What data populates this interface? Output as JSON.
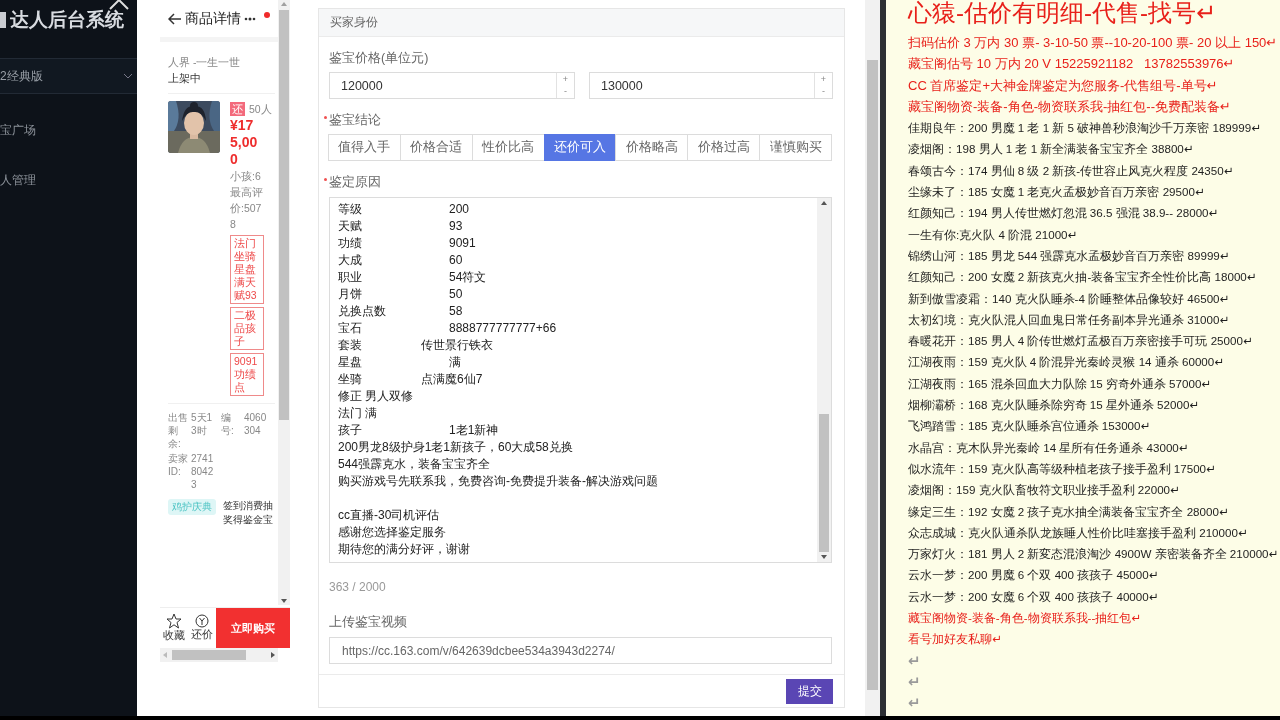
{
  "sidebar": {
    "title": "达人后台系统",
    "version_select": "2经典版",
    "items": [
      {
        "label": "宝广场",
        "selected": false
      },
      {
        "label": "人管理",
        "selected": false
      }
    ]
  },
  "preview": {
    "title": "商品详情",
    "server": "人界 -一生一世",
    "status": "上架中",
    "badge": "还",
    "watchers": "50人",
    "price": "¥175,000",
    "kids": "小孩:6",
    "rating": "最高评价:5078",
    "tags": [
      "法门坐骑星盘满天赋93",
      "二极品孩子",
      "9091功绩点"
    ],
    "info": [
      {
        "label": "出售剩余:",
        "value": "5天13时"
      },
      {
        "label": "编号:",
        "value": "4060304"
      },
      {
        "label": "卖家ID:",
        "value": "274180423"
      }
    ],
    "promo_tag": "鸡护庆典",
    "promo_text": "签到消费抽奖得鉴金宝",
    "favorite": "收藏",
    "bargain": "还价",
    "buy": "立即购买"
  },
  "form": {
    "header": "买家身份",
    "price_label": "鉴宝价格(单位元)",
    "prices": [
      {
        "value": "120000",
        "up": "+",
        "down": "-"
      },
      {
        "value": "130000",
        "up": "+",
        "down": "-"
      }
    ],
    "verdict_label": "鉴宝结论",
    "verdict_required": true,
    "verdicts": [
      {
        "label": "值得入手",
        "selected": false
      },
      {
        "label": "价格合适",
        "selected": false
      },
      {
        "label": "性价比高",
        "selected": false
      },
      {
        "label": "还价可入",
        "selected": true
      },
      {
        "label": "价格略高",
        "selected": false
      },
      {
        "label": "价格过高",
        "selected": false
      },
      {
        "label": "谨慎购买",
        "selected": false
      }
    ],
    "reason_label": "鉴定原因",
    "reason_required": true,
    "reason_lines": [
      {
        "kind": "pair",
        "label": "等级",
        "value": "200"
      },
      {
        "kind": "pair",
        "label": "天赋",
        "value": "93"
      },
      {
        "kind": "pair",
        "label": "功绩",
        "value": "9091"
      },
      {
        "kind": "pair",
        "label": "大成",
        "value": "60"
      },
      {
        "kind": "pair",
        "label": "职业",
        "value": "54符文"
      },
      {
        "kind": "pair",
        "label": "月饼",
        "value": "50"
      },
      {
        "kind": "pair",
        "label": "兑换点数",
        "value": "58"
      },
      {
        "kind": "pair",
        "label": "宝石",
        "value": "8888777777777+66"
      },
      {
        "kind": "pair_near",
        "label": "套装",
        "value": "传世景行铁衣"
      },
      {
        "kind": "pair",
        "label": "星盘",
        "value": "满"
      },
      {
        "kind": "pair_near",
        "label": "坐骑",
        "value": "点满魔6仙7"
      },
      {
        "kind": "text",
        "text": "修正 男人双修"
      },
      {
        "kind": "text",
        "text": "法门 满"
      },
      {
        "kind": "pair",
        "label": "孩子",
        "value": "1老1新神"
      },
      {
        "kind": "text",
        "text": "200男龙8级护身1老1新孩子，60大成58兑换"
      },
      {
        "kind": "text",
        "text": "544强霹克水，装备宝宝齐全"
      },
      {
        "kind": "text",
        "text": "购买游戏号先联系我，免费咨询-免费提升装备-解决游戏问题"
      },
      {
        "kind": "blank"
      },
      {
        "kind": "text",
        "text": "cc直播-30司机评估"
      },
      {
        "kind": "text",
        "text": "感谢您选择鉴定服务"
      },
      {
        "kind": "text",
        "text": "期待您的满分好评，谢谢"
      }
    ],
    "counter": "363 / 2000",
    "video_label": "上传鉴宝视频",
    "video_url": "https://cc.163.com/v/642639dcbee534a3943d2274/",
    "submit": "提交"
  },
  "notes": {
    "lines": [
      {
        "kind": "heading",
        "color": "#e8201a",
        "text": "心猿-估价有明细-代售-找号↵"
      },
      {
        "kind": "notice",
        "color": "#e8201a",
        "text": "扫码估价 3 万内 30 票- 3-10-50 票--10-20-100 票- 20 以上 150↵"
      },
      {
        "kind": "notice",
        "color": "#e8201a",
        "text": "藏宝阁估号 10 万内 20 V 15225921182   13782553976↵"
      },
      {
        "kind": "notice",
        "color": "#e8201a",
        "text": "CC 首席鉴定+大神金牌鉴定为您服务-代售组号-单号↵"
      },
      {
        "kind": "notice",
        "color": "#e8201a",
        "text": "藏宝阁物资-装备-角色-物资联系我-抽红包--免费配装备↵"
      },
      {
        "kind": "line",
        "color": "#1e1e1e",
        "text": "佳期良年：200 男魔 1 老 1 新 5 破神兽秒浪淘沙千万亲密 189999↵"
      },
      {
        "kind": "line",
        "color": "#1e1e1e",
        "text": "凌烟阁：198 男人 1 老 1 新全满装备宝宝齐全 38800↵"
      },
      {
        "kind": "line",
        "color": "#1e1e1e",
        "text": "春颂古今：174 男仙 8 级 2 新孩-传世容止风克火程度 24350↵"
      },
      {
        "kind": "line",
        "color": "#1e1e1e",
        "text": "尘缘未了：185 女魔 1 老克火孟极妙音百万亲密 29500↵"
      },
      {
        "kind": "line",
        "color": "#1e1e1e",
        "text": "红颜知己：194 男人传世燃灯忽混 36.5 强混 38.9-- 28000↵"
      },
      {
        "kind": "line",
        "color": "#1e1e1e",
        "text": "一生有你:克火队 4 阶混 21000↵"
      },
      {
        "kind": "line",
        "color": "#1e1e1e",
        "text": "锦绣山河：185 男龙 544 强霹克水孟极妙音百万亲密 89999↵"
      },
      {
        "kind": "line",
        "color": "#1e1e1e",
        "text": "红颜知己：200 女魔 2 新孩克火抽-装备宝宝齐全性价比高 18000↵"
      },
      {
        "kind": "line",
        "color": "#1e1e1e",
        "text": "新到傲雪凌霜：140 克火队睡杀-4 阶睡整体品像较好 46500↵"
      },
      {
        "kind": "line",
        "color": "#1e1e1e",
        "text": "太初幻境：克火队混人回血鬼日常任务副本异光通杀 31000↵"
      },
      {
        "kind": "line",
        "color": "#1e1e1e",
        "text": "春暖花开：185 男人 4 阶传世燃灯孟极百万亲密接手可玩 25000↵"
      },
      {
        "kind": "line",
        "color": "#1e1e1e",
        "text": "江湖夜雨：159 克火队 4 阶混异光秦岭灵猴 14 通杀 60000↵"
      },
      {
        "kind": "line",
        "color": "#1e1e1e",
        "text": "江湖夜雨：165 混杀回血大力队除 15 穷奇外通杀 57000↵"
      },
      {
        "kind": "line",
        "color": "#1e1e1e",
        "text": "烟柳灞桥：168 克火队睡杀除穷奇 15 星外通杀 52000↵"
      },
      {
        "kind": "line",
        "color": "#1e1e1e",
        "text": "飞鸿踏雪：185 克火队睡杀宫位通杀 153000↵"
      },
      {
        "kind": "line",
        "color": "#1e1e1e",
        "text": "水晶宫：克木队异光秦岭 14 星所有任务通杀 43000↵"
      },
      {
        "kind": "line",
        "color": "#1e1e1e",
        "text": "似水流年：159 克火队高等级种植老孩子接手盈利 17500↵"
      },
      {
        "kind": "line",
        "color": "#1e1e1e",
        "text": "凌烟阁：159 克火队畜牧符文职业接手盈利 22000↵"
      },
      {
        "kind": "line",
        "color": "#1e1e1e",
        "text": "缘定三生：192 女魔 2 孩子克水抽全满装备宝宝齐全 28000↵"
      },
      {
        "kind": "line",
        "color": "#1e1e1e",
        "text": "众志成城：克火队通杀队龙族睡人性价比哇塞接手盈利 210000↵"
      },
      {
        "kind": "line",
        "color": "#1e1e1e",
        "text": "万家灯火：181 男人 2 新変态混浪淘沙 4900W 亲密装备齐全 210000↵"
      },
      {
        "kind": "line",
        "color": "#1e1e1e",
        "text": "云水一梦：200 男魔 6 个双 400 孩孩子 45000↵"
      },
      {
        "kind": "line",
        "color": "#1e1e1e",
        "text": "云水一梦：200 女魔 6 个双 400 孩孩子 40000↵"
      },
      {
        "kind": "line",
        "color": "#e8201a",
        "text": "藏宝阁物资-装备-角色-物资联系我--抽红包↵"
      },
      {
        "kind": "line",
        "color": "#e8201a",
        "text": "看号加好友私聊↵"
      },
      {
        "kind": "mark",
        "color": "#9a9a9a",
        "text": "↵"
      },
      {
        "kind": "mark",
        "color": "#9a9a9a",
        "text": "↵"
      },
      {
        "kind": "mark",
        "color": "#9a9a9a",
        "text": "↵"
      }
    ]
  }
}
